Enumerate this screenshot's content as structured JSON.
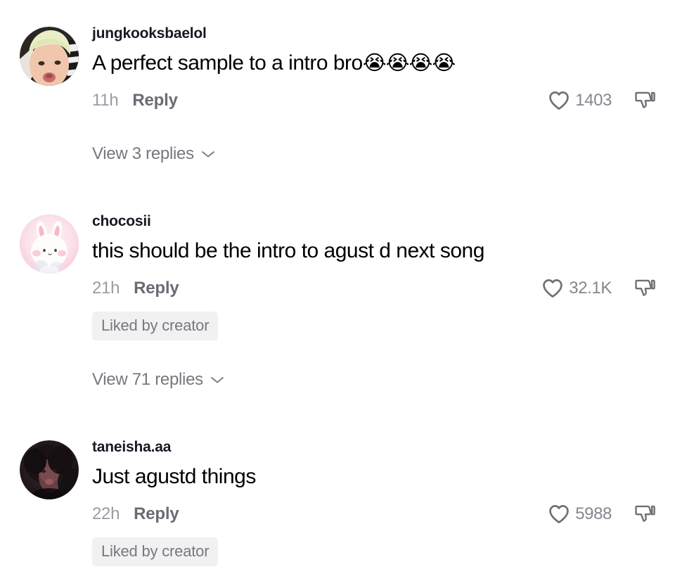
{
  "page": {
    "app": "TikTok",
    "view": "comments-list",
    "background_color": "#ffffff"
  },
  "colors": {
    "username_text": "#161823",
    "comment_text": "#000000",
    "timestamp_text": "#9b9ba4",
    "reply_text": "#6b6b75",
    "like_count_text": "#86868f",
    "badge_background": "#f1f1f2",
    "badge_text": "#777781",
    "icon_stroke": "#6f7075"
  },
  "icons": {
    "heart": "heart-outline-icon",
    "dislike": "thumbs-down-outline-icon",
    "chevron": "chevron-down-icon"
  },
  "labels": {
    "reply": "Reply",
    "liked_by_creator": "Liked by creator"
  },
  "comments": [
    {
      "username": "jungkooksbaelol",
      "text": "A perfect sample to a intro bro",
      "emoji": "😭😭😭😭",
      "timestamp": "11h",
      "reply_label": "Reply",
      "like_count": "1403",
      "liked_by_creator": false,
      "liked_by_creator_label": "Liked by creator",
      "view_replies_label": "View 3 replies",
      "reply_count": 3,
      "avatar": "photo-person-light-hair"
    },
    {
      "username": "chocosii",
      "text": "this should be the intro to agust d next song",
      "emoji": "",
      "timestamp": "21h",
      "reply_label": "Reply",
      "like_count": "32.1K",
      "liked_by_creator": true,
      "liked_by_creator_label": "Liked by creator",
      "view_replies_label": "View 71 replies",
      "reply_count": 71,
      "avatar": "illustration-pink-bunny"
    },
    {
      "username": "taneisha.aa",
      "text": "Just agustd things",
      "emoji": "",
      "timestamp": "22h",
      "reply_label": "Reply",
      "like_count": "5988",
      "liked_by_creator": true,
      "liked_by_creator_label": "Liked by creator",
      "view_replies_label": "",
      "reply_count": 0,
      "avatar": "photo-person-dark"
    }
  ]
}
